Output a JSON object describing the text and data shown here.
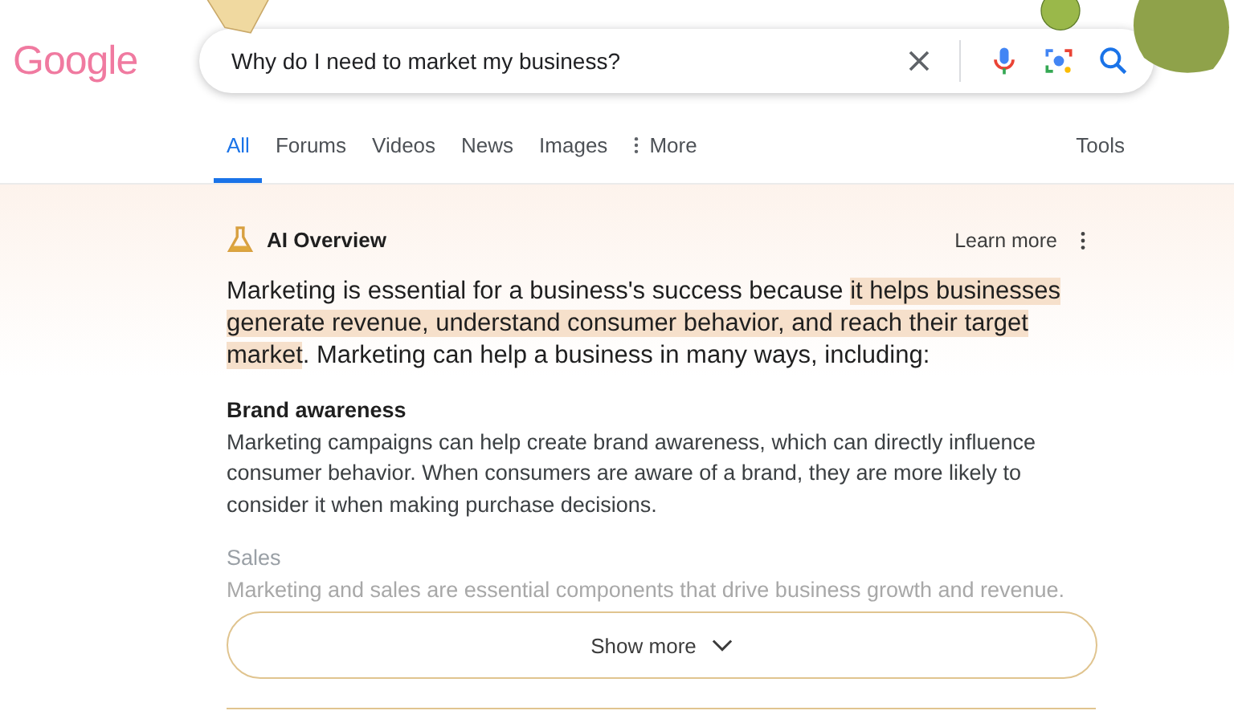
{
  "logo": {
    "text": "Google"
  },
  "search": {
    "value": "Why do I need to market my business?"
  },
  "tabs": [
    {
      "label": "All",
      "selected": true
    },
    {
      "label": "Forums",
      "selected": false
    },
    {
      "label": "Videos",
      "selected": false
    },
    {
      "label": "News",
      "selected": false
    },
    {
      "label": "Images",
      "selected": false
    },
    {
      "label": "More",
      "selected": false,
      "kind": "menu"
    }
  ],
  "tools": "Tools",
  "overview": {
    "title": "AI Overview",
    "learn_more": "Learn more",
    "summary": [
      {
        "text": "Marketing is essential for a business's success because ",
        "highlighted": false
      },
      {
        "text": "it helps businesses generate revenue, understand consumer behavior, and reach their target market",
        "highlighted": true
      },
      {
        "text": ". Marketing can help a business in many ways, including:",
        "highlighted": false
      }
    ],
    "sections": [
      {
        "heading": "Brand awareness",
        "body": "Marketing campaigns can help create brand awareness, which can directly influence consumer behavior. When consumers are aware of a brand, they are more likely to consider it when making purchase decisions.",
        "faded": false
      },
      {
        "heading": "Sales",
        "body": "Marketing and sales are essential components that drive business growth and revenue.",
        "faded": true
      }
    ],
    "show_more": "Show more"
  }
}
